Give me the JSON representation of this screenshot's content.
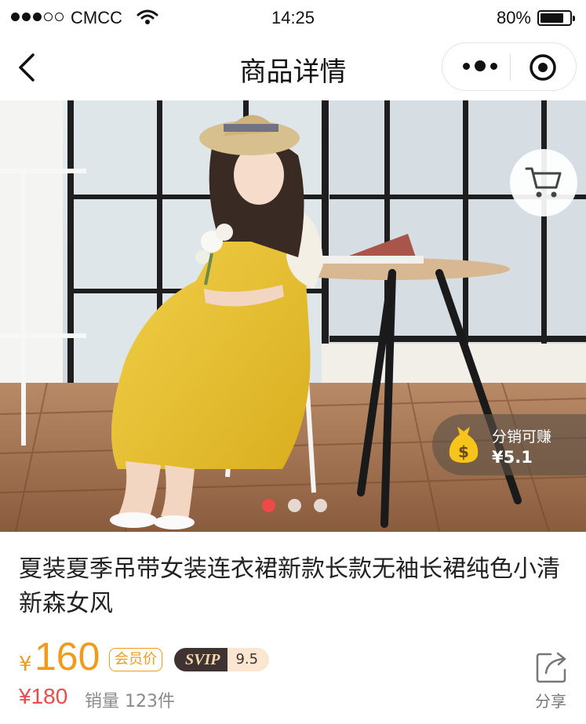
{
  "status_bar": {
    "carrier": "CMCC",
    "time": "14:25",
    "battery": "80%"
  },
  "nav": {
    "title": "商品详情"
  },
  "hero": {
    "image_count": 3,
    "active_index": 0,
    "distribution": {
      "label": "分销可赚",
      "value": "¥5.1"
    }
  },
  "product": {
    "title": "夏装夏季吊带女装连衣裙新款长款无袖长裙纯色小清新森女风",
    "currency": "¥",
    "price": "160",
    "member_tag": "会员价",
    "svip_label": "SVIP",
    "svip_discount": "9.5折",
    "original_price": "¥180",
    "sales": "销量 123件",
    "share_label": "分享"
  },
  "colors": {
    "accent_orange": "#f39a1b",
    "price_red": "#ef4a4a",
    "svip_dark": "#3e3332"
  }
}
